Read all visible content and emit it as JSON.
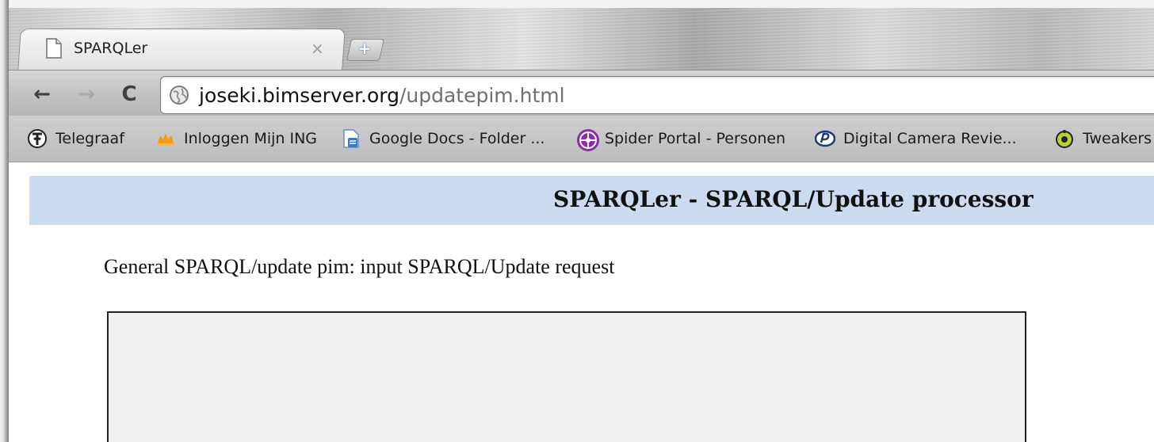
{
  "browser": {
    "tab": {
      "title": "SPARQLer",
      "close_glyph": "×",
      "icon": "page-icon"
    },
    "new_tab_glyph": "+",
    "nav": {
      "back_glyph": "←",
      "forward_glyph": "→",
      "reload_glyph": "C"
    },
    "address": {
      "host": "joseki.bimserver.org",
      "path": "/updatepim.html",
      "icon": "globe-icon"
    },
    "bookmarks": [
      {
        "label": "Telegraaf",
        "icon": "telegraaf-icon"
      },
      {
        "label": "Inloggen Mijn ING",
        "icon": "ing-lion-icon"
      },
      {
        "label": "Google Docs - Folder ...",
        "icon": "google-docs-icon"
      },
      {
        "label": "Spider Portal - Personen",
        "icon": "spider-portal-icon"
      },
      {
        "label": "Digital Camera Revie...",
        "icon": "dpreview-icon"
      },
      {
        "label": "Tweakers",
        "icon": "tweakers-icon"
      }
    ]
  },
  "page": {
    "title": "SPARQLer - SPARQL/Update processor",
    "intro": "General SPARQL/update pim: input SPARQL/Update request",
    "request_value": ""
  },
  "colors": {
    "header_bar": "#cbdcf1",
    "textarea_bg": "#f1f1f1"
  }
}
